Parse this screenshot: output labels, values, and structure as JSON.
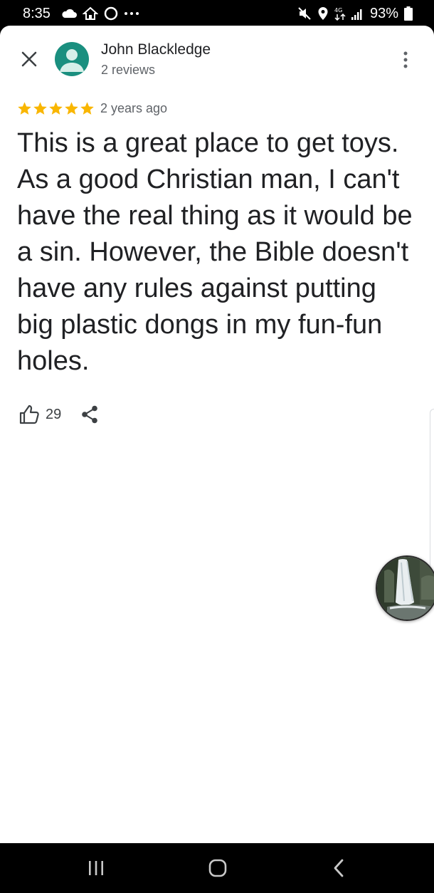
{
  "status_bar": {
    "time": "8:35",
    "battery": "93%",
    "icons_left": [
      "cloud-icon",
      "home-icon",
      "alexa-ring-icon",
      "more-dots-icon"
    ],
    "icons_right": [
      "mute-icon",
      "location-icon",
      "data-transfer-icon",
      "signal-icon",
      "battery-icon"
    ]
  },
  "review": {
    "author_name": "John Blackledge",
    "author_reviews": "2 reviews",
    "rating": 5,
    "rating_max": 5,
    "date": "2 years ago",
    "text": "This is a great place to get toys. As a good Christian man, I can't have the real thing as it would be a sin. However, the Bible doesn't have any rules against putting big plastic dongs in my fun-fun holes.",
    "like_count": "29"
  },
  "icons": {
    "close": "close-icon",
    "avatar": "person-avatar-icon",
    "more": "more-vert-icon",
    "star": "star-icon",
    "like": "thumb-up-icon",
    "share": "share-icon"
  },
  "nav_bar": {
    "items": [
      "recent-apps-icon",
      "home-icon",
      "back-icon"
    ]
  },
  "colors": {
    "star": "#F9B600",
    "avatar_bg": "#1A8F7F",
    "text_primary": "#202124",
    "text_secondary": "#5F6368"
  }
}
